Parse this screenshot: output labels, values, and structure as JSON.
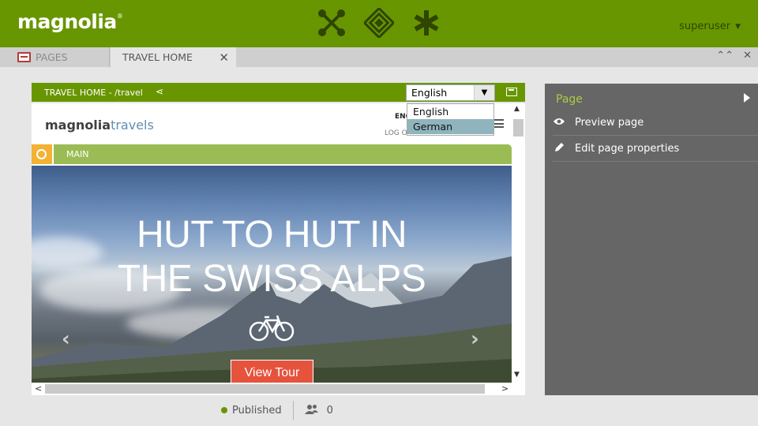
{
  "topbar": {
    "logo": "magnolia",
    "logo_mark": "®",
    "app_icons": [
      "apps-launcher-icon",
      "pulse-icon",
      "favorites-icon"
    ],
    "user": "superuser",
    "brand_color": "#689600"
  },
  "tabs": {
    "pages_label": "PAGES",
    "travel_label": "TRAVEL HOME",
    "close_glyph": "✕",
    "tools": [
      "⌃⌃",
      "✕"
    ]
  },
  "editor": {
    "breadcrumb": "TRAVEL HOME - /travel",
    "language_value": "English",
    "language_options": [
      "English",
      "German"
    ],
    "hovered_option": "German"
  },
  "page_preview": {
    "site_logo_main": "magnolia",
    "site_logo_sub": "travels",
    "nav_language": "ENG",
    "nav_logout": "LOG O",
    "area_label": "MAIN",
    "hero_title_line1": "HUT TO HUT IN",
    "hero_title_line2": "THE SWISS ALPS",
    "cta_label": "View Tour",
    "prev_glyph": "‹",
    "next_glyph": "›"
  },
  "actionbar": {
    "section": "Page",
    "items": [
      {
        "label": "Preview page",
        "icon": "eye-icon"
      },
      {
        "label": "Edit page properties",
        "icon": "pencil-icon"
      }
    ]
  },
  "status": {
    "publish_state": "Published",
    "publish_color": "#689600",
    "users_count": "0"
  }
}
